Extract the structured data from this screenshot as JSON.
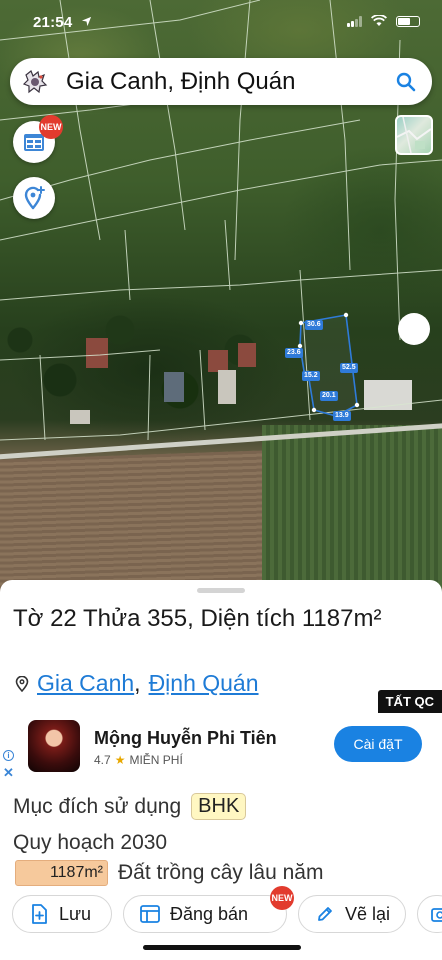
{
  "status_bar": {
    "time": "21:54"
  },
  "search": {
    "query": "Gia Canh, Định Quán"
  },
  "map": {
    "new_badge": "NEW",
    "dimensions": [
      "30.6",
      "23.6",
      "52.5",
      "15.2",
      "20.1",
      "13.9"
    ]
  },
  "parcel": {
    "title": "Tờ 22 Thửa 355, Diện tích 1187m²",
    "commune": "Gia Canh",
    "separator": ",",
    "district": "Định Quán"
  },
  "ad": {
    "tag": "TẤT QC",
    "info_symbol": "i",
    "close_symbol": "✕",
    "app_name": "Mộng Huyễn Phi Tiên",
    "rating": "4.7",
    "star": "★",
    "price": "MIỄN PHÍ",
    "install_label": "Cài đặT"
  },
  "details": {
    "purpose_label": "Mục đích sử dụng",
    "purpose_code": "BHK",
    "plan_label": "Quy hoạch 2030",
    "area_value": "1187m²",
    "zone_label": "Đất trồng cây lâu năm"
  },
  "actions": {
    "save_label": "Lưu",
    "post_label": "Đăng bán",
    "post_badge": "NEW",
    "redraw_label": "Vẽ lại"
  },
  "colors": {
    "accent_blue": "#1a82e2",
    "link_blue": "#1e7bd6",
    "badge_red": "#e23b2e",
    "area_chip": "#f6c99c",
    "bhk_chip": "#fff7c2"
  }
}
